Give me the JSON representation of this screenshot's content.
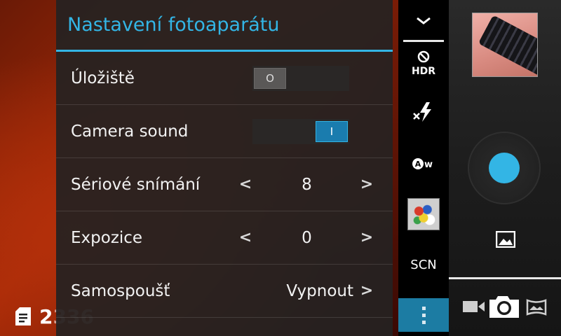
{
  "storage": {
    "icon": "sd-card-icon",
    "remaining_first": "2",
    "remaining_rest": "336"
  },
  "settings": {
    "title": "Nastavení fotoaparátu",
    "storage": {
      "label": "Úložiště",
      "state": "off",
      "knob_text": "O"
    },
    "camera_sound": {
      "label": "Camera sound",
      "state": "on",
      "knob_text": "I"
    },
    "burst": {
      "label": "Sériové snímání",
      "value": "8"
    },
    "exposure": {
      "label": "Expozice",
      "value": "0"
    },
    "timer": {
      "label": "Samospoušť",
      "value": "Vypnout"
    },
    "prev_glyph": "<",
    "next_glyph": ">"
  },
  "quick": {
    "hdr_label": "HDR",
    "scn_label": "SCN"
  },
  "colors": {
    "accent": "#33b5e5",
    "menu_button": "#1c7ca3"
  }
}
